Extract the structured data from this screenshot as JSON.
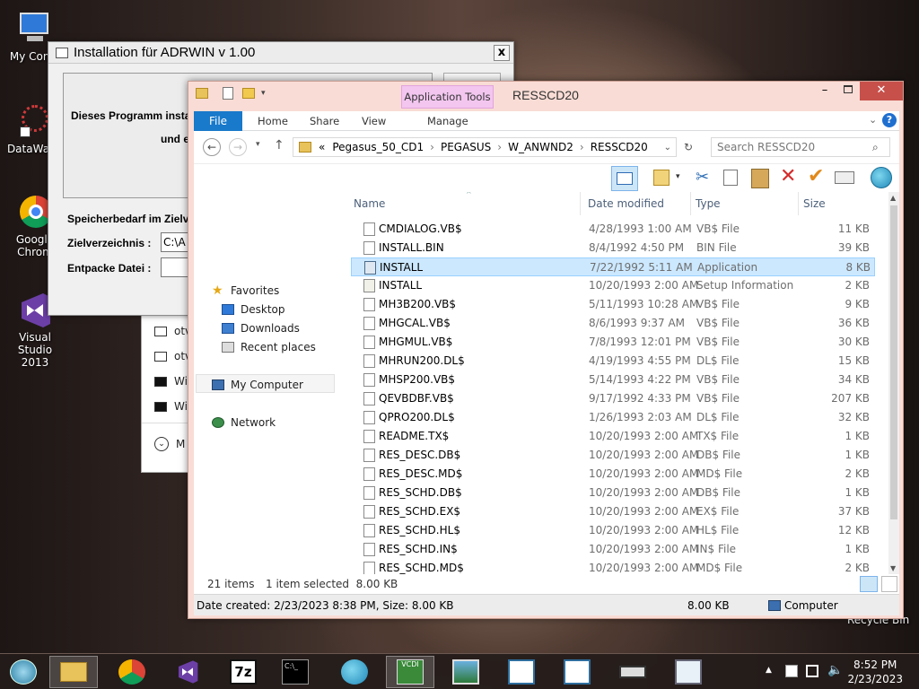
{
  "desktop": {
    "icons": [
      {
        "label": "My Comp"
      },
      {
        "label": "DataWage"
      },
      {
        "label": "Google Chrom"
      },
      {
        "label": "Visual Studio 2013"
      }
    ],
    "recycle": "Recycle Bin"
  },
  "setup": {
    "title": "Installation für ADRWIN v 1.00",
    "close": "x",
    "text1": "Dieses Programm instal",
    "text2": "und e",
    "req": "Speicherbedarf im Zielv",
    "target_label": "Zielverzeichnis :",
    "target_value": "C:\\A",
    "unpack_label": "Entpacke Datei :",
    "unpack_value": ""
  },
  "behind": {
    "rows": [
      "otv",
      "otv",
      "Wi",
      "Wi"
    ],
    "more": "M"
  },
  "explorer": {
    "title": "RESSCD20",
    "app_tools": "Application Tools",
    "tabs": {
      "file": "File",
      "home": "Home",
      "share": "Share",
      "view": "View",
      "manage": "Manage"
    },
    "crumbs": [
      "«",
      "Pegasus_50_CD1",
      "PEGASUS",
      "W_ANWND2",
      "RESSCD20"
    ],
    "search_placeholder": "Search RESSCD20",
    "nav": {
      "favorites": "Favorites",
      "desktop": "Desktop",
      "downloads": "Downloads",
      "recent": "Recent places",
      "computer": "My Computer",
      "network": "Network"
    },
    "headers": {
      "name": "Name",
      "date": "Date modified",
      "type": "Type",
      "size": "Size"
    },
    "files": [
      {
        "name": "CMDIALOG.VB$",
        "date": "4/28/1993 1:00 AM",
        "type": "VB$ File",
        "size": "11 KB"
      },
      {
        "name": "INSTALL.BIN",
        "date": "8/4/1992 4:50 PM",
        "type": "BIN File",
        "size": "39 KB"
      },
      {
        "name": "INSTALL",
        "date": "7/22/1992 5:11 AM",
        "type": "Application",
        "size": "8 KB",
        "selected": true
      },
      {
        "name": "INSTALL",
        "date": "10/20/1993 2:00 AM",
        "type": "Setup Information",
        "size": "2 KB"
      },
      {
        "name": "MH3B200.VB$",
        "date": "5/11/1993 10:28 AM",
        "type": "VB$ File",
        "size": "9 KB"
      },
      {
        "name": "MHGCAL.VB$",
        "date": "8/6/1993 9:37 AM",
        "type": "VB$ File",
        "size": "36 KB"
      },
      {
        "name": "MHGMUL.VB$",
        "date": "7/8/1993 12:01 PM",
        "type": "VB$ File",
        "size": "30 KB"
      },
      {
        "name": "MHRUN200.DL$",
        "date": "4/19/1993 4:55 PM",
        "type": "DL$ File",
        "size": "15 KB"
      },
      {
        "name": "MHSP200.VB$",
        "date": "5/14/1993 4:22 PM",
        "type": "VB$ File",
        "size": "34 KB"
      },
      {
        "name": "QEVBDBF.VB$",
        "date": "9/17/1992 4:33 PM",
        "type": "VB$ File",
        "size": "207 KB"
      },
      {
        "name": "QPRO200.DL$",
        "date": "1/26/1993 2:03 AM",
        "type": "DL$ File",
        "size": "32 KB"
      },
      {
        "name": "README.TX$",
        "date": "10/20/1993 2:00 AM",
        "type": "TX$ File",
        "size": "1 KB"
      },
      {
        "name": "RES_DESC.DB$",
        "date": "10/20/1993 2:00 AM",
        "type": "DB$ File",
        "size": "1 KB"
      },
      {
        "name": "RES_DESC.MD$",
        "date": "10/20/1993 2:00 AM",
        "type": "MD$ File",
        "size": "2 KB"
      },
      {
        "name": "RES_SCHD.DB$",
        "date": "10/20/1993 2:00 AM",
        "type": "DB$ File",
        "size": "1 KB"
      },
      {
        "name": "RES_SCHD.EX$",
        "date": "10/20/1993 2:00 AM",
        "type": "EX$ File",
        "size": "37 KB"
      },
      {
        "name": "RES_SCHD.HL$",
        "date": "10/20/1993 2:00 AM",
        "type": "HL$ File",
        "size": "12 KB"
      },
      {
        "name": "RES_SCHD.IN$",
        "date": "10/20/1993 2:00 AM",
        "type": "IN$ File",
        "size": "1 KB"
      },
      {
        "name": "RES_SCHD.MD$",
        "date": "10/20/1993 2:00 AM",
        "type": "MD$ File",
        "size": "2 KB"
      }
    ],
    "status": {
      "items": "21 items",
      "selected": "1 item selected  8.00 KB",
      "created": "Date created: 2/23/2023 8:38 PM, Size: 8.00 KB",
      "size": "8.00 KB",
      "computer": "Computer"
    }
  },
  "taskbar": {
    "time": "8:52 PM",
    "date": "2/23/2023",
    "sevenzip": "7z",
    "cmd": "C:\\_",
    "vcdi": "VCDI"
  }
}
